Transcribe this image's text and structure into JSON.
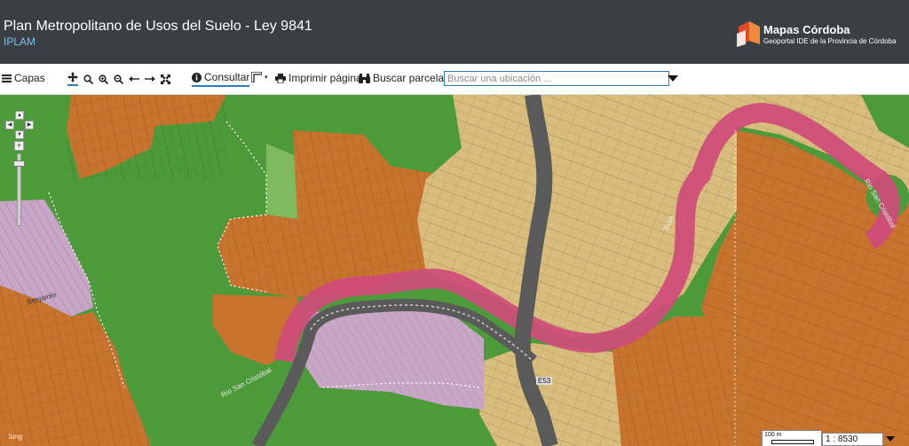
{
  "header": {
    "title": "Plan Metropolitano de Usos del Suelo - Ley 9841",
    "subtitle": "IPLAM",
    "brand_name": "Mapas Córdoba",
    "brand_sub": "Geoportal IDE de la Provincia de Córdoba"
  },
  "toolbar": {
    "layers_label": "Capas",
    "consult_label": "Consultar",
    "print_label": "Imprimir página",
    "parcels_label": "Buscar parcelas",
    "search_placeholder": "Buscar una ubicación ..."
  },
  "map": {
    "labels": {
      "river_west": "Río San Cristóbal",
      "river_east": "Río San Cristóbal",
      "road_a": "Ruta",
      "street_a": "Benjamín",
      "road_number": "E53"
    },
    "scale_label": "100 m",
    "scale_ratio": "1 : 8530",
    "attribution": "bing",
    "colors": {
      "green": "#4d9a3a",
      "orange": "#c8742f",
      "tan": "#d9bd7c",
      "pink": "#cf4b79",
      "lilac": "#c8a6c6",
      "road": "#5a5a5a"
    }
  }
}
